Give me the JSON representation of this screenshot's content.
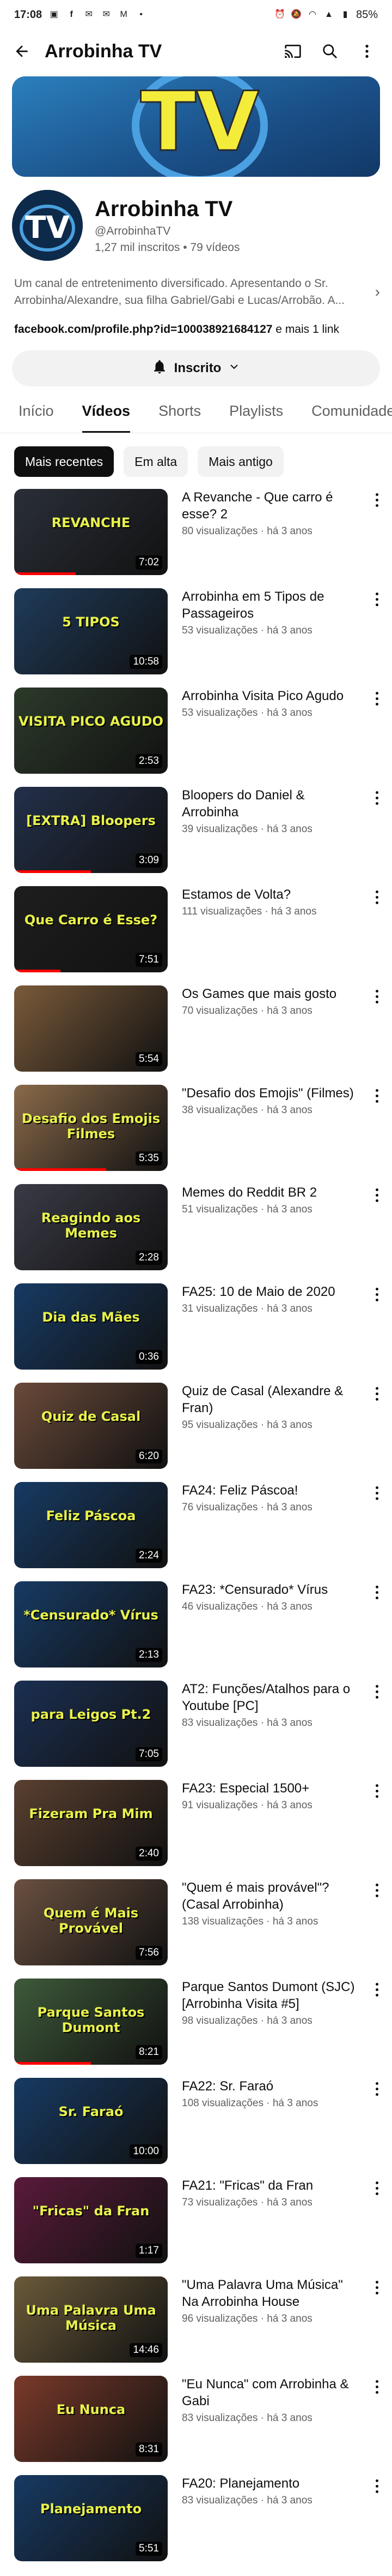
{
  "status_bar": {
    "time": "17:08",
    "battery": "85%"
  },
  "header": {
    "title": "Arrobinha TV"
  },
  "banner": {
    "logo_text": "TV"
  },
  "channel": {
    "name": "Arrobinha TV",
    "handle": "@ArrobinhaTV",
    "stats": "1,27 mil inscritos • 79 vídeos",
    "avatar_text": "TV",
    "description": "Um canal de entretenimento diversificado. Apresentando o Sr. Arrobinha/Alexandre, sua filha Gabriel/Gabi e Lucas/Arrobão. A...",
    "link": "facebook.com/profile.php?id=100038921684127",
    "link_suffix": " e mais 1 link",
    "subscribe_label": "Inscrito"
  },
  "tabs": [
    "Início",
    "Vídeos",
    "Shorts",
    "Playlists",
    "Comunidade"
  ],
  "chips": [
    "Mais recentes",
    "Em alta",
    "Mais antigo"
  ],
  "videos": [
    {
      "title": "A Revanche - Que carro é esse? 2",
      "meta": "80 visualizações · há 3 anos",
      "duration": "7:02",
      "thumb_text": "REVANCHE",
      "bg": "#2a2f38",
      "progress": 0.4
    },
    {
      "title": "Arrobinha em 5 Tipos de Passageiros",
      "meta": "53 visualizações · há 3 anos",
      "duration": "10:58",
      "thumb_text": "5 TIPOS",
      "bg": "#1f3b5a",
      "progress": 0
    },
    {
      "title": "Arrobinha Visita Pico Agudo",
      "meta": "53 visualizações · há 3 anos",
      "duration": "2:53",
      "thumb_text": "VISITA PICO AGUDO",
      "bg": "#2c3a2a",
      "progress": 0
    },
    {
      "title": "Bloopers do Daniel & Arrobinha",
      "meta": "39 visualizações · há 3 anos",
      "duration": "3:09",
      "thumb_text": "[EXTRA] Bloopers",
      "bg": "#23304a",
      "progress": 0.5
    },
    {
      "title": "Estamos de Volta?",
      "meta": "111 visualizações · há 3 anos",
      "duration": "7:51",
      "thumb_text": "Que Carro é Esse?",
      "bg": "#1e1e1e",
      "progress": 0.3
    },
    {
      "title": "Os Games que mais gosto",
      "meta": "70 visualizações · há 3 anos",
      "duration": "5:54",
      "thumb_text": "",
      "bg": "#7a5a3a",
      "progress": 0
    },
    {
      "title": "\"Desafio dos Emojis\" (Filmes)",
      "meta": "38 visualizações · há 3 anos",
      "duration": "5:35",
      "thumb_text": "Desafio dos Emojis Filmes",
      "bg": "#8a6a4a",
      "progress": 0.6
    },
    {
      "title": "Memes do Reddit BR 2",
      "meta": "51 visualizações · há 3 anos",
      "duration": "2:28",
      "thumb_text": "Reagindo aos Memes",
      "bg": "#3a3a46",
      "progress": 0
    },
    {
      "title": "FA25: 10 de Maio de 2020",
      "meta": "31 visualizações · há 3 anos",
      "duration": "0:36",
      "thumb_text": "Dia das Mães",
      "bg": "#173a63",
      "progress": 0
    },
    {
      "title": "Quiz de Casal (Alexandre & Fran)",
      "meta": "95 visualizações · há 3 anos",
      "duration": "6:20",
      "thumb_text": "Quiz de Casal",
      "bg": "#6a4a3a",
      "progress": 0
    },
    {
      "title": "FA24: Feliz Páscoa!",
      "meta": "76 visualizações · há 3 anos",
      "duration": "2:24",
      "thumb_text": "Feliz Páscoa",
      "bg": "#173a63",
      "progress": 0
    },
    {
      "title": "FA23: *Censurado* Vírus",
      "meta": "46 visualizações · há 3 anos",
      "duration": "2:13",
      "thumb_text": "*Censurado* Vírus",
      "bg": "#173a63",
      "progress": 0
    },
    {
      "title": "AT2: Funções/Atalhos para o Youtube [PC]",
      "meta": "83 visualizações · há 3 anos",
      "duration": "7:05",
      "thumb_text": "para Leigos Pt.2",
      "bg": "#1b2f52",
      "progress": 0
    },
    {
      "title": "FA23: Especial 1500+",
      "meta": "91 visualizações · há 3 anos",
      "duration": "2:40",
      "thumb_text": "Fizeram Pra Mim",
      "bg": "#5a4030",
      "progress": 0
    },
    {
      "title": "\"Quem é mais provável\"? (Casal Arrobinha)",
      "meta": "138 visualizações · há 3 anos",
      "duration": "7:56",
      "thumb_text": "Quem é Mais Provável",
      "bg": "#6a5040",
      "progress": 0
    },
    {
      "title": "Parque Santos Dumont (SJC) [Arrobinha Visita #5]",
      "meta": "98 visualizações · há 3 anos",
      "duration": "8:21",
      "thumb_text": "Parque Santos Dumont",
      "bg": "#3e5a3a",
      "progress": 0.5
    },
    {
      "title": "FA22: Sr. Faraó",
      "meta": "108 visualizações · há 3 anos",
      "duration": "10:00",
      "thumb_text": "Sr. Faraó",
      "bg": "#173a63",
      "progress": 0
    },
    {
      "title": "FA21: \"Fricas\" da Fran",
      "meta": "73 visualizações · há 3 anos",
      "duration": "1:17",
      "thumb_text": "\"Fricas\" da Fran",
      "bg": "#5a1a3a",
      "progress": 0
    },
    {
      "title": "\"Uma Palavra Uma Música\" Na Arrobinha House",
      "meta": "96 visualizações · há 3 anos",
      "duration": "14:46",
      "thumb_text": "Uma Palavra Uma Música",
      "bg": "#6a5a3a",
      "progress": 0
    },
    {
      "title": "\"Eu Nunca\" com Arrobinha & Gabi",
      "meta": "83 visualizações · há 3 anos",
      "duration": "8:31",
      "thumb_text": "Eu Nunca",
      "bg": "#7a3a2a",
      "progress": 0
    },
    {
      "title": "FA20: Planejamento",
      "meta": "83 visualizações · há 3 anos",
      "duration": "5:51",
      "thumb_text": "Planejamento",
      "bg": "#173a63",
      "progress": 0
    }
  ],
  "colors": {
    "accent": "#0f0f0f",
    "progress": "#ff0000",
    "logo": "#f4ec3a",
    "logo_ring": "#4aa0e0"
  }
}
